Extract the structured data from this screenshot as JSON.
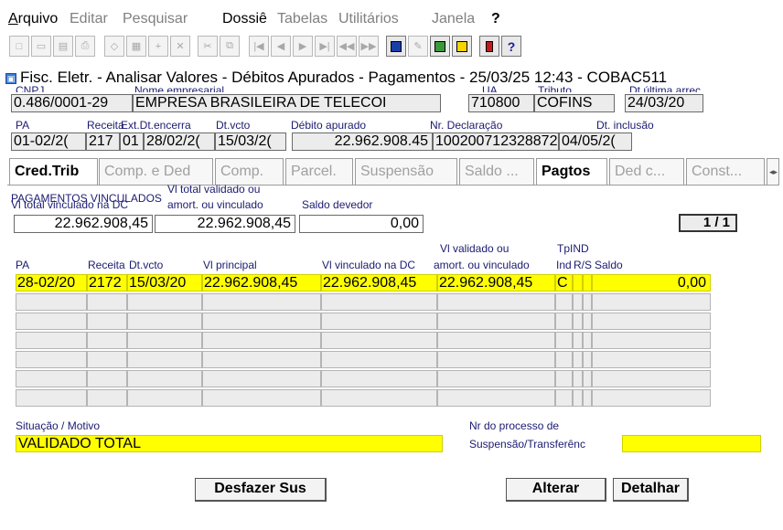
{
  "menu": {
    "arquivo": "Arquivo",
    "editar": "Editar",
    "pesquisar": "Pesquisar",
    "dossie": "Dossiê",
    "tabelas": "Tabelas",
    "utilitarios": "Utilitários",
    "janela": "Janela",
    "help": "?"
  },
  "window": {
    "title": "Fisc. Eletr. - Analisar Valores - Débitos Apurados - Pagamentos - 25/03/25 12:43 - COBAC511"
  },
  "header": {
    "labels": {
      "cnpj": "CNPJ",
      "nome": "Nome empresarial",
      "ua": "UA",
      "tributo": "Tributo",
      "dt_ultima": "Dt última arrec.",
      "pa": "PA",
      "receita": "Receita",
      "ext_dt": "Ext.Dt.encerra",
      "dt_vcto": "Dt.vcto",
      "debito": "Débito apurado",
      "nr_decl": "Nr. Declaração",
      "dt_inclusao": "Dt. inclusão"
    },
    "values": {
      "cnpj": "0.486/0001-29",
      "nome": "EMPRESA BRASILEIRA DE TELECOI",
      "ua": "710800",
      "tributo": "COFINS",
      "dt_ultima": "24/03/20",
      "pa": "01-02/2(",
      "receita": "217",
      "ext_dt": "01",
      "enc_dt": "28/02/2(",
      "dt_vcto": "15/03/2(",
      "debito": "22.962.908.45",
      "nr_decl": "100200712328872",
      "dt_inclusao": "04/05/2("
    }
  },
  "tabs": [
    {
      "label": "Cred.Trib",
      "active": true
    },
    {
      "label": "Comp. e Ded",
      "active": false
    },
    {
      "label": "Comp.",
      "active": false
    },
    {
      "label": "Parcel.",
      "active": false
    },
    {
      "label": "Suspensão",
      "active": false
    },
    {
      "label": "Saldo ...",
      "active": false
    },
    {
      "label": "Pagtos",
      "active": true
    },
    {
      "label": "Ded c...",
      "active": false
    },
    {
      "label": "Const...",
      "active": false
    }
  ],
  "summary": {
    "section_title": "PAGAMENTOS VINCULADOS",
    "label_vl_total_vinc": "Vl total vinculado na DC",
    "label_vl_total_valid_1": "Vl total validado ou",
    "label_vl_total_valid_2": "amort. ou vinculado",
    "label_saldo": "Saldo devedor",
    "vl_total_vinc": "22.962.908,45",
    "vl_total_valid": "22.962.908,45",
    "saldo": "0,00",
    "record_counter": "1 / 1"
  },
  "grid": {
    "headers": {
      "pa": "PA",
      "receita": "Receita",
      "dt_vcto": "Dt.vcto",
      "vl_principal": "Vl principal",
      "vl_vinculado": "Vl vinculado na DC",
      "vl_validado_1": "Vl validado ou",
      "vl_validado_2": "amort. ou vinculado",
      "tp": "Tp",
      "ind": "IND",
      "ind2": "Ind",
      "rs": "R/S",
      "saldo": "Saldo"
    },
    "row": {
      "pa": "28-02/20",
      "receita": "2172",
      "dt_vcto": "15/03/20",
      "vl_principal": "22.962.908,45",
      "vl_vinculado": "22.962.908,45",
      "vl_validado": "22.962.908,45",
      "tp": "C",
      "ind": "",
      "rs": "",
      "saldo": "0,00"
    }
  },
  "footer": {
    "label_situacao": "Situação / Motivo",
    "situacao": "VALIDADO TOTAL",
    "label_processo_1": "Nr do processo de",
    "label_processo_2": "Suspensão/Transferênc",
    "processo": "",
    "btn_desfazer": "Desfazer Sus",
    "btn_alterar": "Alterar",
    "btn_detalhar": "Detalhar"
  },
  "colors": {
    "highlight": "#ffff00",
    "field_bg": "#ececec",
    "label": "#1b1b72"
  }
}
